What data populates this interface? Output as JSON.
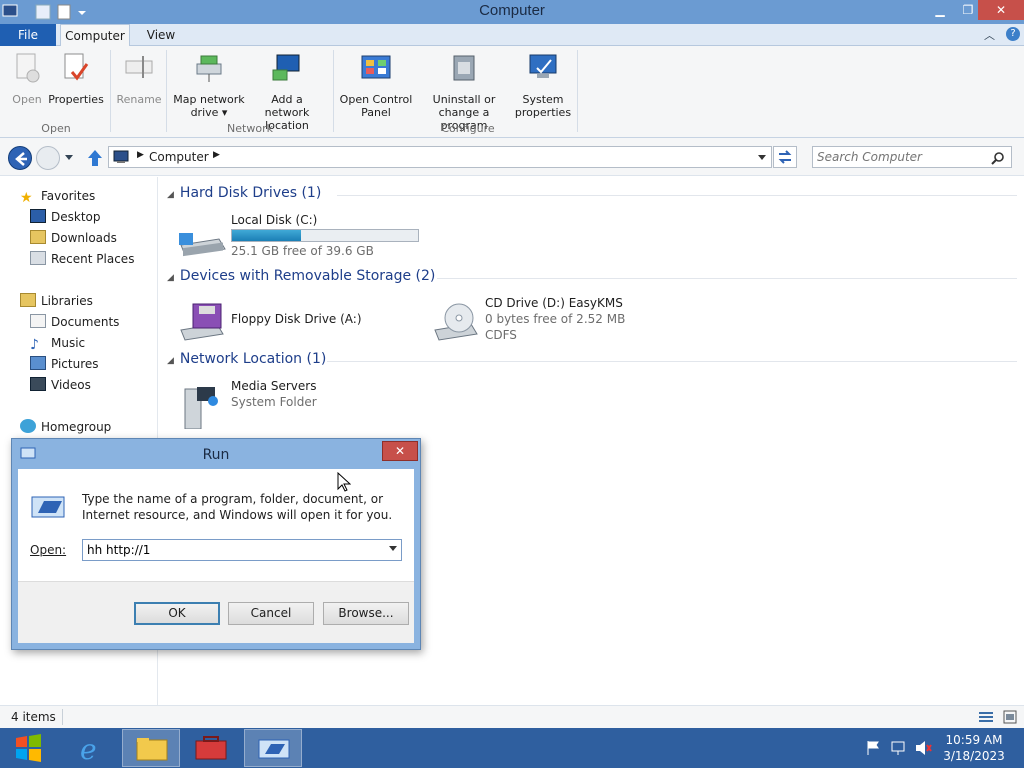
{
  "window": {
    "title": "Computer"
  },
  "tabs": {
    "file": "File",
    "computer": "Computer",
    "view": "View"
  },
  "ribbon": {
    "open": {
      "label": "Open"
    },
    "properties": {
      "label": "Properties"
    },
    "rename": {
      "label": "Rename"
    },
    "map_drive": {
      "line1": "Map network",
      "line2": "drive ▾"
    },
    "add_location": {
      "line1": "Add a network",
      "line2": "location"
    },
    "control_panel": {
      "line1": "Open Control",
      "line2": "Panel"
    },
    "uninstall": {
      "line1": "Uninstall or",
      "line2": "change a program"
    },
    "system_props": {
      "line1": "System",
      "line2": "properties"
    },
    "groups": {
      "open": "Open",
      "network": "Network",
      "configure": "Configure"
    }
  },
  "address": {
    "crumb": "Computer",
    "search_placeholder": "Search Computer"
  },
  "nav": {
    "favorites": "Favorites",
    "desktop": "Desktop",
    "downloads": "Downloads",
    "recent": "Recent Places",
    "libraries": "Libraries",
    "documents": "Documents",
    "music": "Music",
    "pictures": "Pictures",
    "videos": "Videos",
    "homegroup": "Homegroup"
  },
  "sections": {
    "hdd": "Hard Disk Drives (1)",
    "removable": "Devices with Removable Storage (2)",
    "network": "Network Location (1)"
  },
  "drives": {
    "c": {
      "name": "Local Disk (C:)",
      "free": "25.1 GB free of 39.6 GB",
      "used_fraction": 0.37
    },
    "a": {
      "name": "Floppy Disk Drive (A:)"
    },
    "d": {
      "name": "CD Drive (D:) EasyKMS",
      "free": "0 bytes free of 2.52 MB",
      "fs": "CDFS"
    },
    "media": {
      "name": "Media Servers",
      "type": "System Folder"
    }
  },
  "status": {
    "items": "4 items"
  },
  "clock": {
    "time": "10:59 AM",
    "date": "3/18/2023"
  },
  "run": {
    "title": "Run",
    "close": "✕",
    "description": "Type the name of a program, folder, document, or Internet resource, and Windows will open it for you.",
    "open_label": "Open:",
    "command": "hh http://1",
    "ok": "OK",
    "cancel": "Cancel",
    "browse": "Browse..."
  }
}
